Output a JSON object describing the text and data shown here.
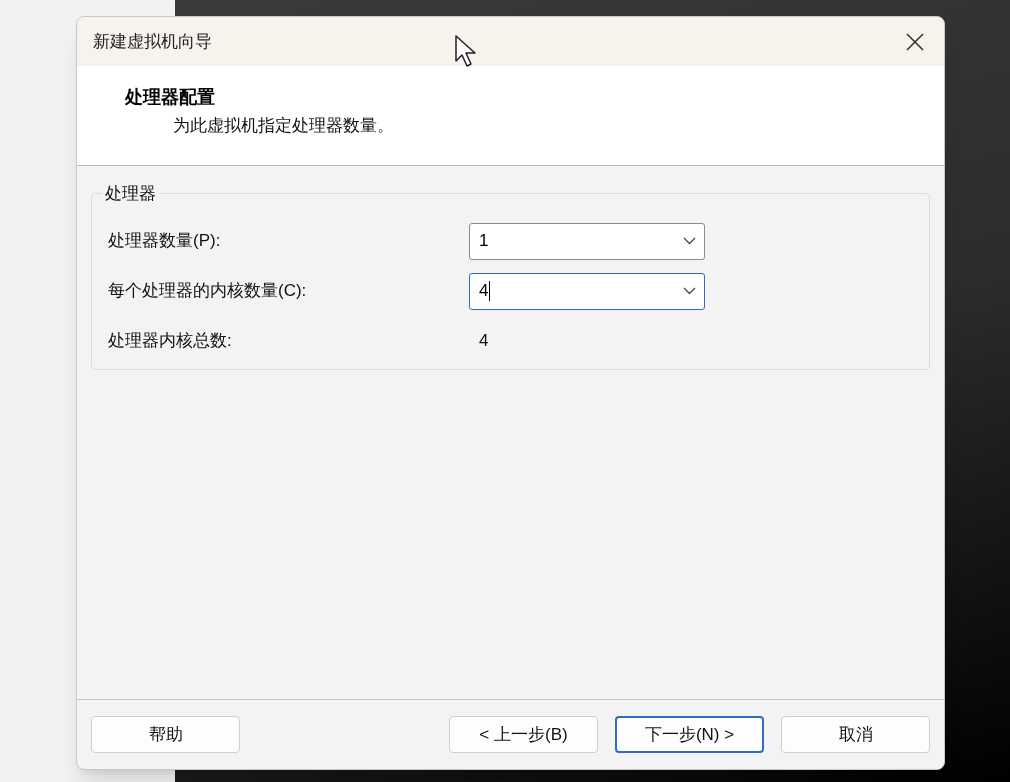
{
  "window": {
    "title": "新建虚拟机向导"
  },
  "header": {
    "title": "处理器配置",
    "subtitle": "为此虚拟机指定处理器数量。"
  },
  "group": {
    "title": "处理器",
    "fields": [
      {
        "kind": "combo",
        "label": "处理器数量(P):",
        "value": "1",
        "focused": false
      },
      {
        "kind": "combo",
        "label": "每个处理器的内核数量(C):",
        "value": "4",
        "focused": true
      },
      {
        "kind": "readout",
        "label": "处理器内核总数:",
        "value": "4"
      }
    ]
  },
  "left_buttons": [
    {
      "label": "帮助",
      "default": false
    }
  ],
  "right_buttons": [
    {
      "label": "< 上一步(B)",
      "default": false
    },
    {
      "label": "下一步(N) >",
      "default": true
    },
    {
      "label": "取消",
      "default": false
    }
  ]
}
